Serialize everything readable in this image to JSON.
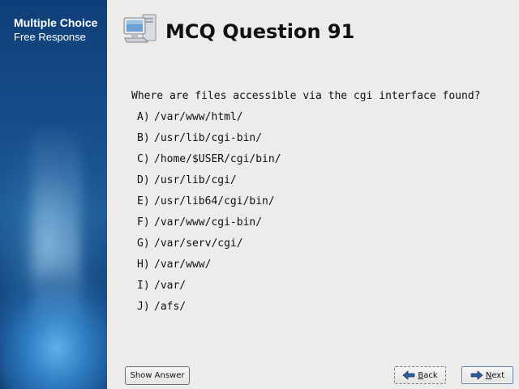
{
  "sidebar": {
    "title": "Multiple Choice",
    "subtitle": "Free Response"
  },
  "header": {
    "title": "MCQ Question 91",
    "icon": "computer-icon"
  },
  "question": {
    "text": "Where are files accessible via the cgi interface found?",
    "options": [
      {
        "letter": "A)",
        "text": "/var/www/html/"
      },
      {
        "letter": "B)",
        "text": "/usr/lib/cgi-bin/"
      },
      {
        "letter": "C)",
        "text": "/home/$USER/cgi/bin/"
      },
      {
        "letter": "D)",
        "text": "/usr/lib/cgi/"
      },
      {
        "letter": "E)",
        "text": "/usr/lib64/cgi/bin/"
      },
      {
        "letter": "F)",
        "text": "/var/www/cgi-bin/"
      },
      {
        "letter": "G)",
        "text": "/var/serv/cgi/"
      },
      {
        "letter": "H)",
        "text": "/var/www/"
      },
      {
        "letter": "I)",
        "text": "/var/"
      },
      {
        "letter": "J)",
        "text": "/afs/"
      }
    ]
  },
  "buttons": {
    "show_answer": "Show Answer",
    "back_mnemonic": "B",
    "back_rest": "ack",
    "next_mnemonic": "N",
    "next_rest": "ext"
  },
  "colors": {
    "background": "#edeceb",
    "sidebar_dark": "#0f3f78",
    "arrow_blue": "#2c5d9a"
  }
}
